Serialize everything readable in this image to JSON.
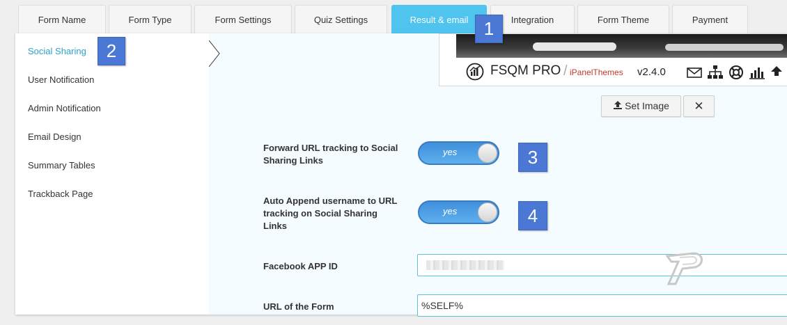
{
  "tabs": [
    {
      "label": "Form Name"
    },
    {
      "label": "Form Type"
    },
    {
      "label": "Form Settings"
    },
    {
      "label": "Quiz Settings"
    },
    {
      "label": "Result & email",
      "active": true
    },
    {
      "label": "Integration"
    },
    {
      "label": "Form Theme"
    },
    {
      "label": "Payment"
    }
  ],
  "sidebar": {
    "items": [
      {
        "label": "Social Sharing",
        "active": true
      },
      {
        "label": "User Notification"
      },
      {
        "label": "Admin Notification"
      },
      {
        "label": "Email Design"
      },
      {
        "label": "Summary Tables"
      },
      {
        "label": "Trackback Page"
      }
    ]
  },
  "badges": [
    "1",
    "2",
    "3",
    "4"
  ],
  "preview": {
    "brand": "FSQM PRO",
    "separator": "/",
    "sub": "iPanelThemes",
    "version": "v2.4.0",
    "icons": [
      "envelope-icon",
      "sitemap-icon",
      "lifebuoy-icon",
      "bar-chart-icon",
      "upload-icon"
    ]
  },
  "buttons": {
    "set_image": "Set Image",
    "remove": "✕"
  },
  "fields": {
    "forward_tracking": {
      "label": "Forward URL tracking to Social Sharing Links",
      "toggle": "yes",
      "on": true
    },
    "auto_append": {
      "label": "Auto Append username to URL tracking on Social Sharing Links",
      "toggle": "yes",
      "on": true
    },
    "facebook_app_id": {
      "label": "Facebook APP ID",
      "value": ""
    },
    "form_url": {
      "label": "URL of the Form",
      "value": "%SELF%"
    }
  },
  "colors": {
    "accent": "#4ec4ef",
    "badge": "#4a78d4",
    "toggle": "#4b9ee0",
    "sub_brand": "#c0392b"
  }
}
